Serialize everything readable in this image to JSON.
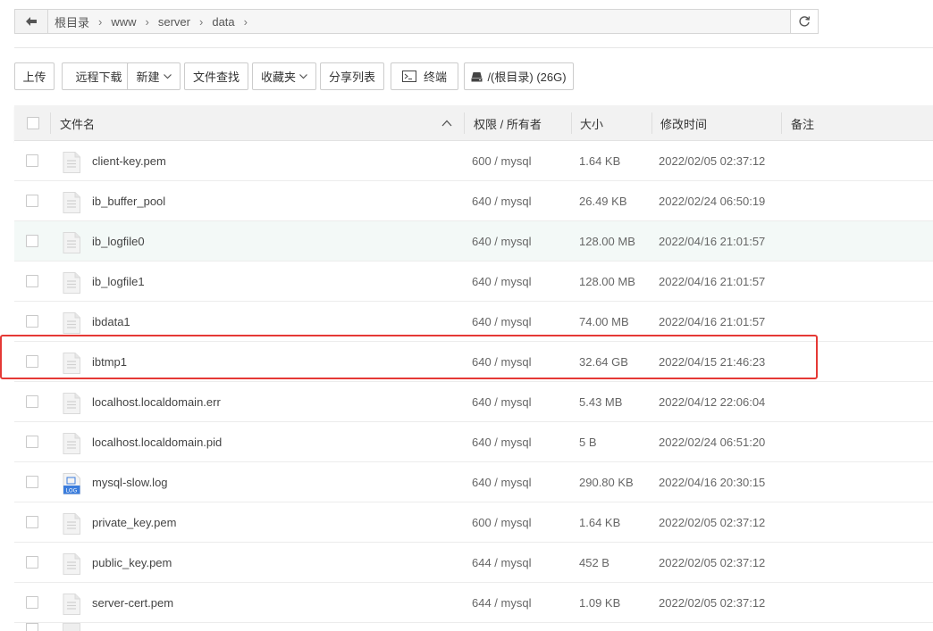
{
  "breadcrumb": {
    "items": [
      "根目录",
      "www",
      "server",
      "data"
    ]
  },
  "toolbar": {
    "upload": "上传",
    "remote_download": "远程下载",
    "new": "新建",
    "file_search": "文件查找",
    "favorites": "收藏夹",
    "share_list": "分享列表",
    "terminal": "终端",
    "disk": "/(根目录) (26G)"
  },
  "table": {
    "headers": {
      "name": "文件名",
      "perm_owner": "权限 / 所有者",
      "size": "大小",
      "mtime": "修改时间",
      "note": "备注"
    },
    "rows": [
      {
        "name": "client-key.pem",
        "perm": "600 / mysql",
        "size": "1.64 KB",
        "mtime": "2022/02/05 02:37:12",
        "icon": "text-file-icon"
      },
      {
        "name": "ib_buffer_pool",
        "perm": "640 / mysql",
        "size": "26.49 KB",
        "mtime": "2022/02/24 06:50:19",
        "icon": "text-file-icon"
      },
      {
        "name": "ib_logfile0",
        "perm": "640 / mysql",
        "size": "128.00 MB",
        "mtime": "2022/04/16 21:01:57",
        "icon": "text-file-icon"
      },
      {
        "name": "ib_logfile1",
        "perm": "640 / mysql",
        "size": "128.00 MB",
        "mtime": "2022/04/16 21:01:57",
        "icon": "text-file-icon"
      },
      {
        "name": "ibdata1",
        "perm": "640 / mysql",
        "size": "74.00 MB",
        "mtime": "2022/04/16 21:01:57",
        "icon": "text-file-icon"
      },
      {
        "name": "ibtmp1",
        "perm": "640 / mysql",
        "size": "32.64 GB",
        "mtime": "2022/04/15 21:46:23",
        "icon": "text-file-icon"
      },
      {
        "name": "localhost.localdomain.err",
        "perm": "640 / mysql",
        "size": "5.43 MB",
        "mtime": "2022/04/12 22:06:04",
        "icon": "text-file-icon"
      },
      {
        "name": "localhost.localdomain.pid",
        "perm": "640 / mysql",
        "size": "5 B",
        "mtime": "2022/02/24 06:51:20",
        "icon": "text-file-icon"
      },
      {
        "name": "mysql-slow.log",
        "perm": "640 / mysql",
        "size": "290.80 KB",
        "mtime": "2022/04/16 20:30:15",
        "icon": "log-file-icon"
      },
      {
        "name": "private_key.pem",
        "perm": "600 / mysql",
        "size": "1.64 KB",
        "mtime": "2022/02/05 02:37:12",
        "icon": "text-file-icon"
      },
      {
        "name": "public_key.pem",
        "perm": "644 / mysql",
        "size": "452 B",
        "mtime": "2022/02/05 02:37:12",
        "icon": "text-file-icon"
      },
      {
        "name": "server-cert.pem",
        "perm": "644 / mysql",
        "size": "1.09 KB",
        "mtime": "2022/02/05 02:37:12",
        "icon": "text-file-icon"
      }
    ]
  },
  "colors": {
    "highlight": "#e53935",
    "hover_row": "#f3f9f7",
    "log_icon": "#3b7ddd"
  }
}
